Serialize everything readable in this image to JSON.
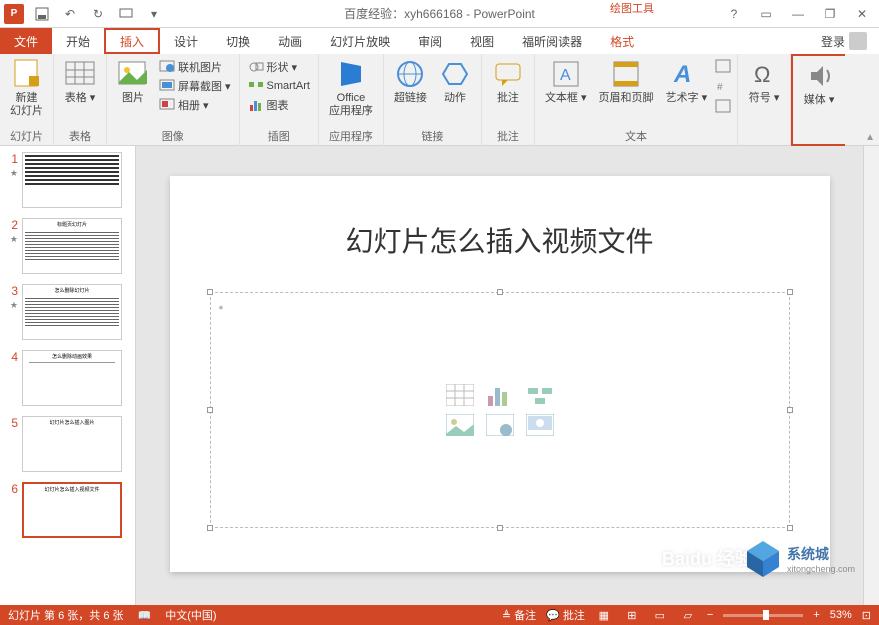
{
  "titlebar": {
    "doc_title": "百度经验：xyh666168 - PowerPoint",
    "tool_context": "绘图工具"
  },
  "qat": {
    "save": "保存",
    "undo": "撤销",
    "redo": "恢复",
    "start": "从头开始"
  },
  "tabs": {
    "file": "文件",
    "home": "开始",
    "insert": "插入",
    "design": "设计",
    "transition": "切换",
    "animation": "动画",
    "slideshow": "幻灯片放映",
    "review": "审阅",
    "view": "视图",
    "foxit": "福昕阅读器",
    "format": "格式",
    "login": "登录"
  },
  "ribbon": {
    "slides": {
      "new_slide": "新建\n幻灯片",
      "group": "幻灯片"
    },
    "tables": {
      "table": "表格",
      "group": "表格"
    },
    "images": {
      "picture": "图片",
      "online_pic": "联机图片",
      "screenshot": "屏幕截图",
      "album": "相册",
      "group": "图像"
    },
    "illus": {
      "shapes": "形状",
      "smartart": "SmartArt",
      "chart": "图表",
      "group": "插图"
    },
    "apps": {
      "office_apps": "Office\n应用程序",
      "group": "应用程序"
    },
    "links": {
      "hyperlink": "超链接",
      "action": "动作",
      "group": "链接"
    },
    "comments": {
      "comment": "批注",
      "group": "批注"
    },
    "text": {
      "textbox": "文本框",
      "header_footer": "页眉和页脚",
      "wordart": "艺术字",
      "group": "文本"
    },
    "symbols": {
      "symbol": "符号",
      "group": ""
    },
    "media": {
      "media": "媒体",
      "group": ""
    }
  },
  "thumbs": {
    "items": [
      {
        "num": "1",
        "star": true
      },
      {
        "num": "2",
        "star": true
      },
      {
        "num": "3",
        "star": true
      },
      {
        "num": "4",
        "star": false
      },
      {
        "num": "5",
        "star": false
      },
      {
        "num": "6",
        "star": false
      }
    ]
  },
  "slide": {
    "title_text": "幻灯片怎么插入视频文件"
  },
  "status": {
    "slide_info": "幻灯片 第 6 张，共 6 张",
    "lang": "中文(中国)",
    "notes": "备注",
    "comments": "批注",
    "zoom": "53%"
  },
  "watermark": {
    "text": "系统城",
    "sub": "xitongcheng.com",
    "baidu": "Baidu 经验"
  }
}
